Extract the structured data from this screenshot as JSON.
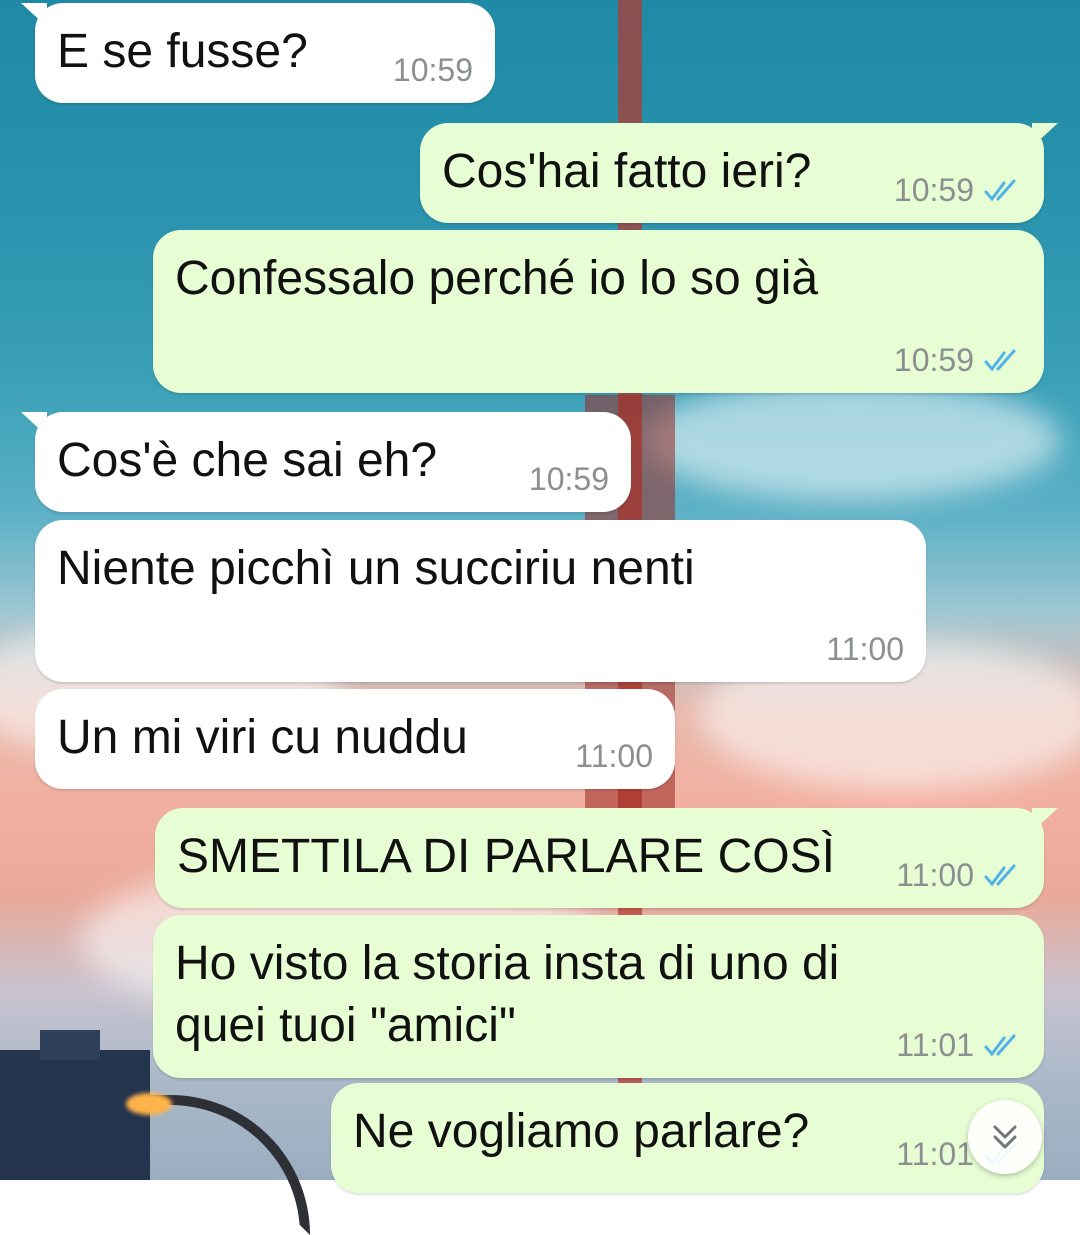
{
  "messages": [
    {
      "direction": "in",
      "text": "E se fusse?",
      "time": "10:59",
      "tail": true
    },
    {
      "direction": "out",
      "text": "Cos'hai fatto ieri?",
      "time": "10:59",
      "status": "read",
      "tail": true
    },
    {
      "direction": "out",
      "text": "Confessalo perché io lo so già",
      "time": "10:59",
      "status": "read",
      "tail": false
    },
    {
      "direction": "in",
      "text": "Cos'è che sai eh?",
      "time": "10:59",
      "tail": true
    },
    {
      "direction": "in",
      "text": "Niente picchì un succiriu nenti",
      "time": "11:00",
      "tail": false
    },
    {
      "direction": "in",
      "text": "Un mi viri cu nuddu",
      "time": "11:00",
      "tail": false
    },
    {
      "direction": "out",
      "text": "SMETTILA DI PARLARE COSÌ",
      "time": "11:00",
      "status": "read",
      "tail": true
    },
    {
      "direction": "out",
      "text": "Ho visto la storia insta di uno di quei tuoi \"amici\"",
      "time": "11:01",
      "status": "read",
      "tail": false
    },
    {
      "direction": "out",
      "text": "Ne vogliamo parlare?",
      "time": "11:01",
      "status": "read",
      "tail": false
    }
  ],
  "colors": {
    "incoming_bubble": "#ffffff",
    "outgoing_bubble": "#e7fed4",
    "read_ticks": "#4fb3e8",
    "timestamp": "#8b8f92"
  },
  "icons": {
    "read_receipt": "double-check-icon",
    "scroll_down": "double-chevron-down-icon"
  }
}
